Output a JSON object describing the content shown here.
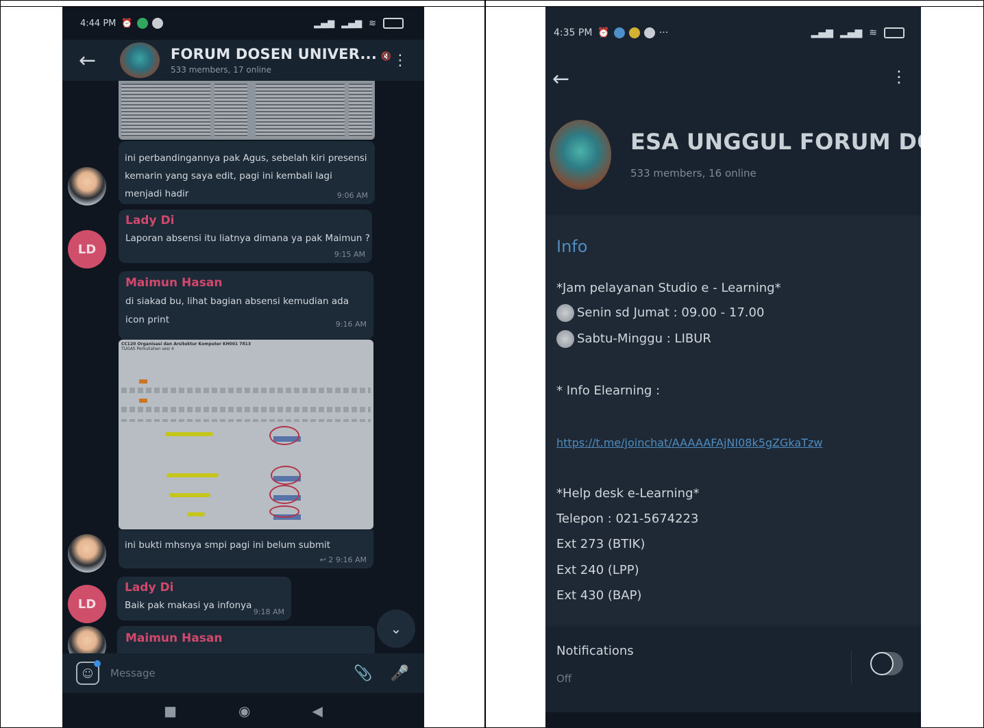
{
  "left": {
    "status": {
      "time": "4:44 PM"
    },
    "header": {
      "title": "FORUM DOSEN UNIVER...",
      "subtitle": "533 members, 17 online"
    },
    "messages": [
      {
        "text": "ini perbandingannya pak Agus, sebelah kiri presensi kemarin yang saya edit, pagi ini kembali lagi menjadi hadir",
        "time": "9:06 AM"
      },
      {
        "sender": "Lady Di",
        "text": "Laporan absensi itu liatnya dimana ya pak Maimun ?",
        "time": "9:15 AM"
      },
      {
        "sender": "Maimun Hasan",
        "text": "di siakad bu, lihat bagian absensi kemudian ada icon print",
        "time": "9:16 AM"
      },
      {
        "image_title": "CC120 Organisasi dan Arsitektur Komputer KH001 7813",
        "image_subtitle": "TUGAS Perkuliahan sesi 4",
        "text": "ini bukti mhsnya smpi pagi ini belum submit",
        "replies": "2",
        "time": "9:16 AM"
      },
      {
        "sender": "Lady Di",
        "text": "Baik pak makasi ya infonya",
        "time": "9:18 AM"
      },
      {
        "sender": "Maimun Hasan"
      }
    ],
    "avatar_initials": "LD",
    "composer": {
      "placeholder": "Message"
    }
  },
  "right": {
    "status": {
      "time": "4:35 PM",
      "more": "···"
    },
    "header": {
      "title": "ESA UNGGUL   FORUM DOSEN",
      "subtitle": "533 members, 16 online"
    },
    "info": {
      "heading": "Info",
      "jam_title": "*Jam pelayanan Studio e - Learning*",
      "senin": "Senin sd Jumat : 09.00 - 17.00",
      "sabtu": "Sabtu-Minggu : LIBUR",
      "elearning": "* Info Elearning :",
      "link": "https://t.me/joinchat/AAAAAFAjNI08k5gZGkaTzw",
      "helpdesk": "*Help desk e-Learning*",
      "telepon": "Telepon : 021-5674223",
      "ext1": "Ext 273 (BTIK)",
      "ext2": "Ext 240 (LPP)",
      "ext3": "Ext 430 (BAP)"
    },
    "notifications": {
      "title": "Notifications",
      "state": "Off"
    }
  },
  "colors": {
    "sender_name": "#d0496d",
    "link": "#4f8cbf",
    "bg": "#0f1620"
  }
}
